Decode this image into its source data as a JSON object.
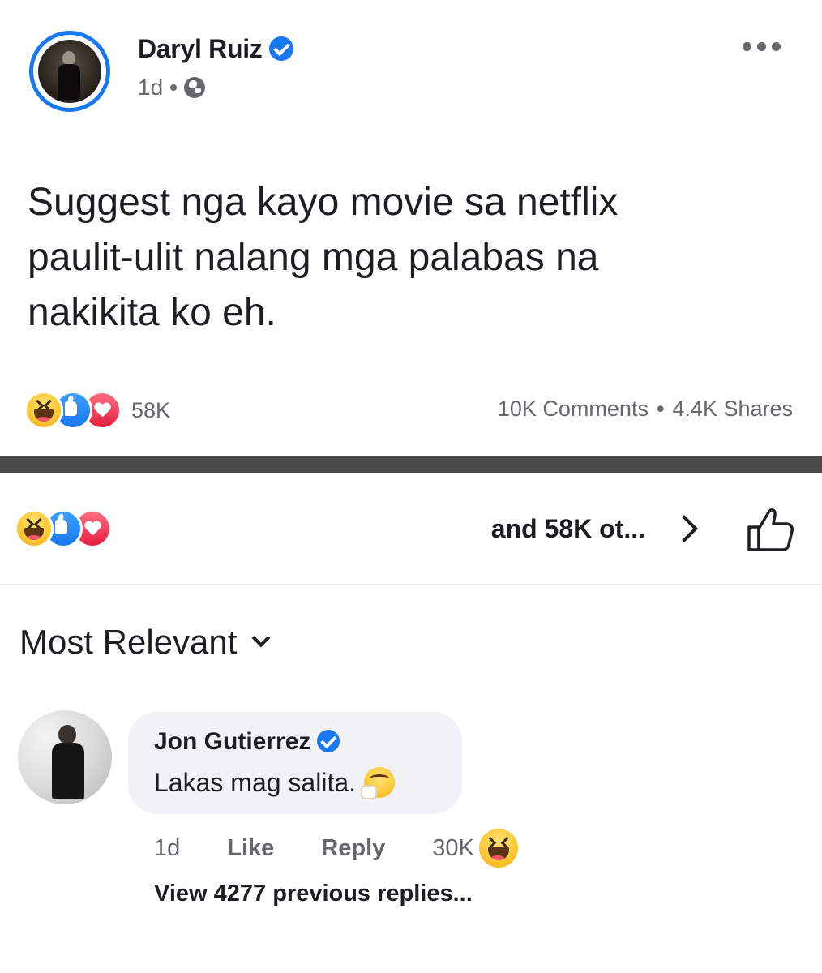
{
  "post": {
    "author": "Daryl Ruiz",
    "time": "1d",
    "privacy_icon": "globe-icon",
    "text_lines": [
      "Suggest nga kayo movie sa netflix",
      "paulit-ulit nalang mga palabas na",
      "nakikita ko eh."
    ],
    "reactions_count": "58K",
    "comments": "10K Comments",
    "shares": "4.4K Shares",
    "separator": "•"
  },
  "reactions_panel": {
    "label": "and 58K ot...",
    "icons": [
      "haha-icon",
      "like-icon",
      "love-icon"
    ]
  },
  "sort": {
    "label": "Most Relevant"
  },
  "comment": {
    "author": "Jon Gutierrez",
    "text": "Lakas mag salita.",
    "emoji": "thinking-face-icon",
    "time": "1d",
    "like_label": "Like",
    "reply_label": "Reply",
    "reaction_count": "30K",
    "view_replies": "View 4277 previous replies..."
  },
  "colors": {
    "accent": "#1877f2",
    "secondary_text": "#65676b",
    "bubble": "#f0f2f5",
    "divider_bar": "#4a4a4a"
  }
}
